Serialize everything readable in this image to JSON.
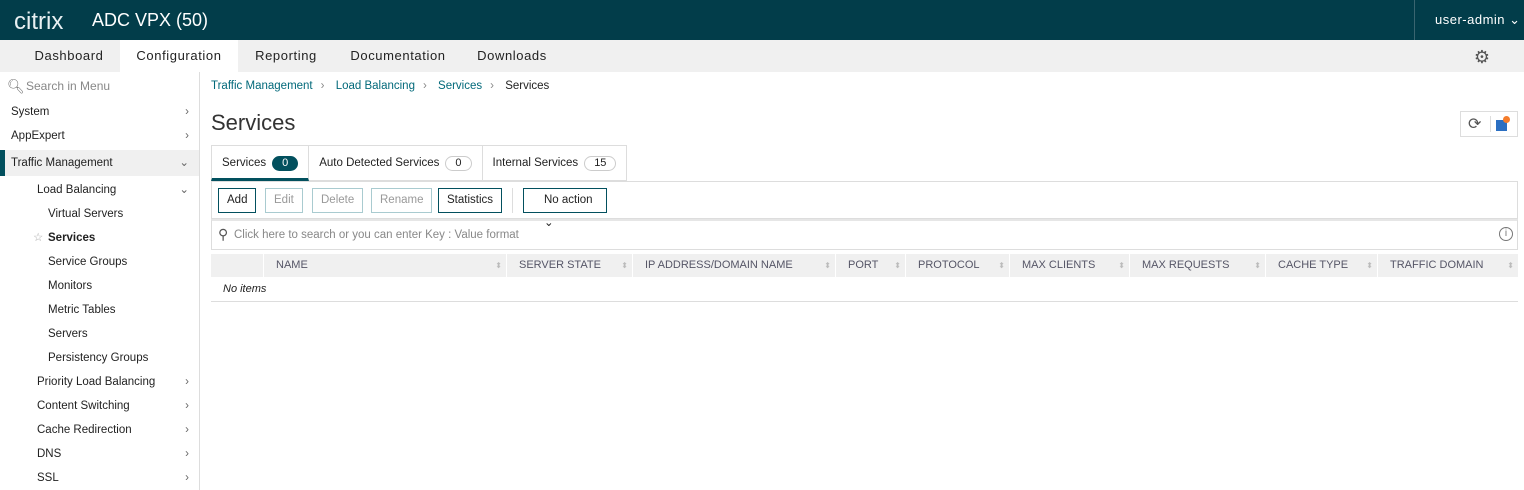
{
  "header": {
    "logo": "citrix",
    "app_title": "ADC VPX (50)",
    "user": "user-admin"
  },
  "nav": {
    "tabs": [
      "Dashboard",
      "Configuration",
      "Reporting",
      "Documentation",
      "Downloads"
    ],
    "active": "Configuration"
  },
  "sidebar": {
    "search_placeholder": "Search in Menu",
    "items": [
      {
        "label": "System"
      },
      {
        "label": "AppExpert"
      },
      {
        "label": "Traffic Management"
      },
      {
        "label": "Load Balancing"
      },
      {
        "label": "Virtual Servers"
      },
      {
        "label": "Services"
      },
      {
        "label": "Service Groups"
      },
      {
        "label": "Monitors"
      },
      {
        "label": "Metric Tables"
      },
      {
        "label": "Servers"
      },
      {
        "label": "Persistency Groups"
      },
      {
        "label": "Priority Load Balancing"
      },
      {
        "label": "Content Switching"
      },
      {
        "label": "Cache Redirection"
      },
      {
        "label": "DNS"
      },
      {
        "label": "SSL"
      }
    ]
  },
  "breadcrumb": [
    "Traffic Management",
    "Load Balancing",
    "Services",
    "Services"
  ],
  "page_title": "Services",
  "tabs": [
    {
      "label": "Services",
      "count": "0"
    },
    {
      "label": "Auto Detected Services",
      "count": "0"
    },
    {
      "label": "Internal Services",
      "count": "15"
    }
  ],
  "toolbar": {
    "add": "Add",
    "edit": "Edit",
    "delete": "Delete",
    "rename": "Rename",
    "statistics": "Statistics",
    "action": "No action"
  },
  "search": {
    "placeholder": "Click here to search or you can enter Key : Value format"
  },
  "table": {
    "columns": [
      "NAME",
      "SERVER STATE",
      "IP ADDRESS/DOMAIN NAME",
      "PORT",
      "PROTOCOL",
      "MAX CLIENTS",
      "MAX REQUESTS",
      "CACHE TYPE",
      "TRAFFIC DOMAIN"
    ],
    "empty": "No items"
  }
}
